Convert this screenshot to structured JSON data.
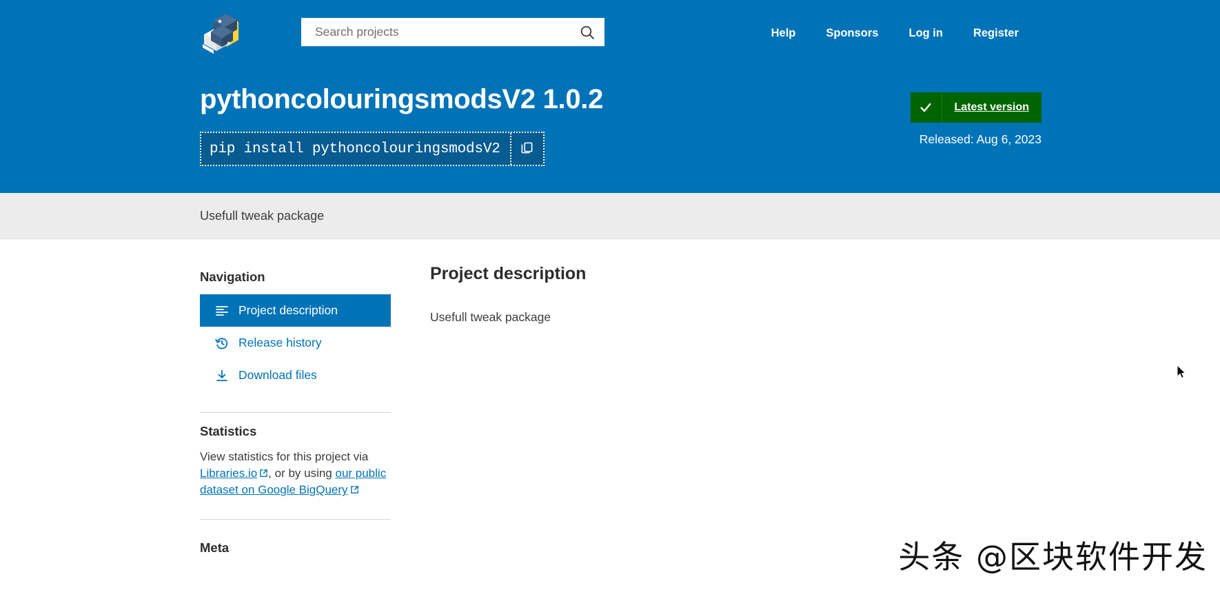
{
  "header": {
    "logo_name": "pypi-logo",
    "search": {
      "placeholder": "Search projects",
      "value": "",
      "icon": "search-icon"
    },
    "nav": [
      {
        "label": "Help"
      },
      {
        "label": "Sponsors"
      },
      {
        "label": "Log in"
      },
      {
        "label": "Register"
      }
    ]
  },
  "hero": {
    "project_name": "pythoncolouringsmodsV2",
    "version": "1.0.2",
    "title": "pythoncolouringsmodsV2 1.0.2",
    "pip_command": "pip install pythoncolouringsmodsV2",
    "copy_icon": "copy-icon",
    "badge": {
      "icon": "check-icon",
      "label": "Latest version",
      "color": "#006400"
    },
    "released": "Released: Aug 6, 2023",
    "accent_color": "#0073b7"
  },
  "summary": {
    "text": "Usefull tweak package"
  },
  "sidebar": {
    "nav_heading": "Navigation",
    "items": [
      {
        "label": "Project description",
        "icon": "align-left-icon",
        "active": true
      },
      {
        "label": "Release history",
        "icon": "history-icon",
        "active": false
      },
      {
        "label": "Download files",
        "icon": "download-icon",
        "active": false
      }
    ],
    "statistics": {
      "heading": "Statistics",
      "intro": "View statistics for this project via",
      "link1": "Libraries.io",
      "middle": ", or by using ",
      "link2": "our public dataset on Google BigQuery",
      "ext_icon": "external-link-icon"
    },
    "meta_heading": "Meta"
  },
  "main": {
    "heading": "Project description",
    "description": "Usefull tweak package"
  },
  "watermark": {
    "text": "头条 @区块软件开发"
  },
  "cursor": {
    "name": "mouse-pointer"
  }
}
